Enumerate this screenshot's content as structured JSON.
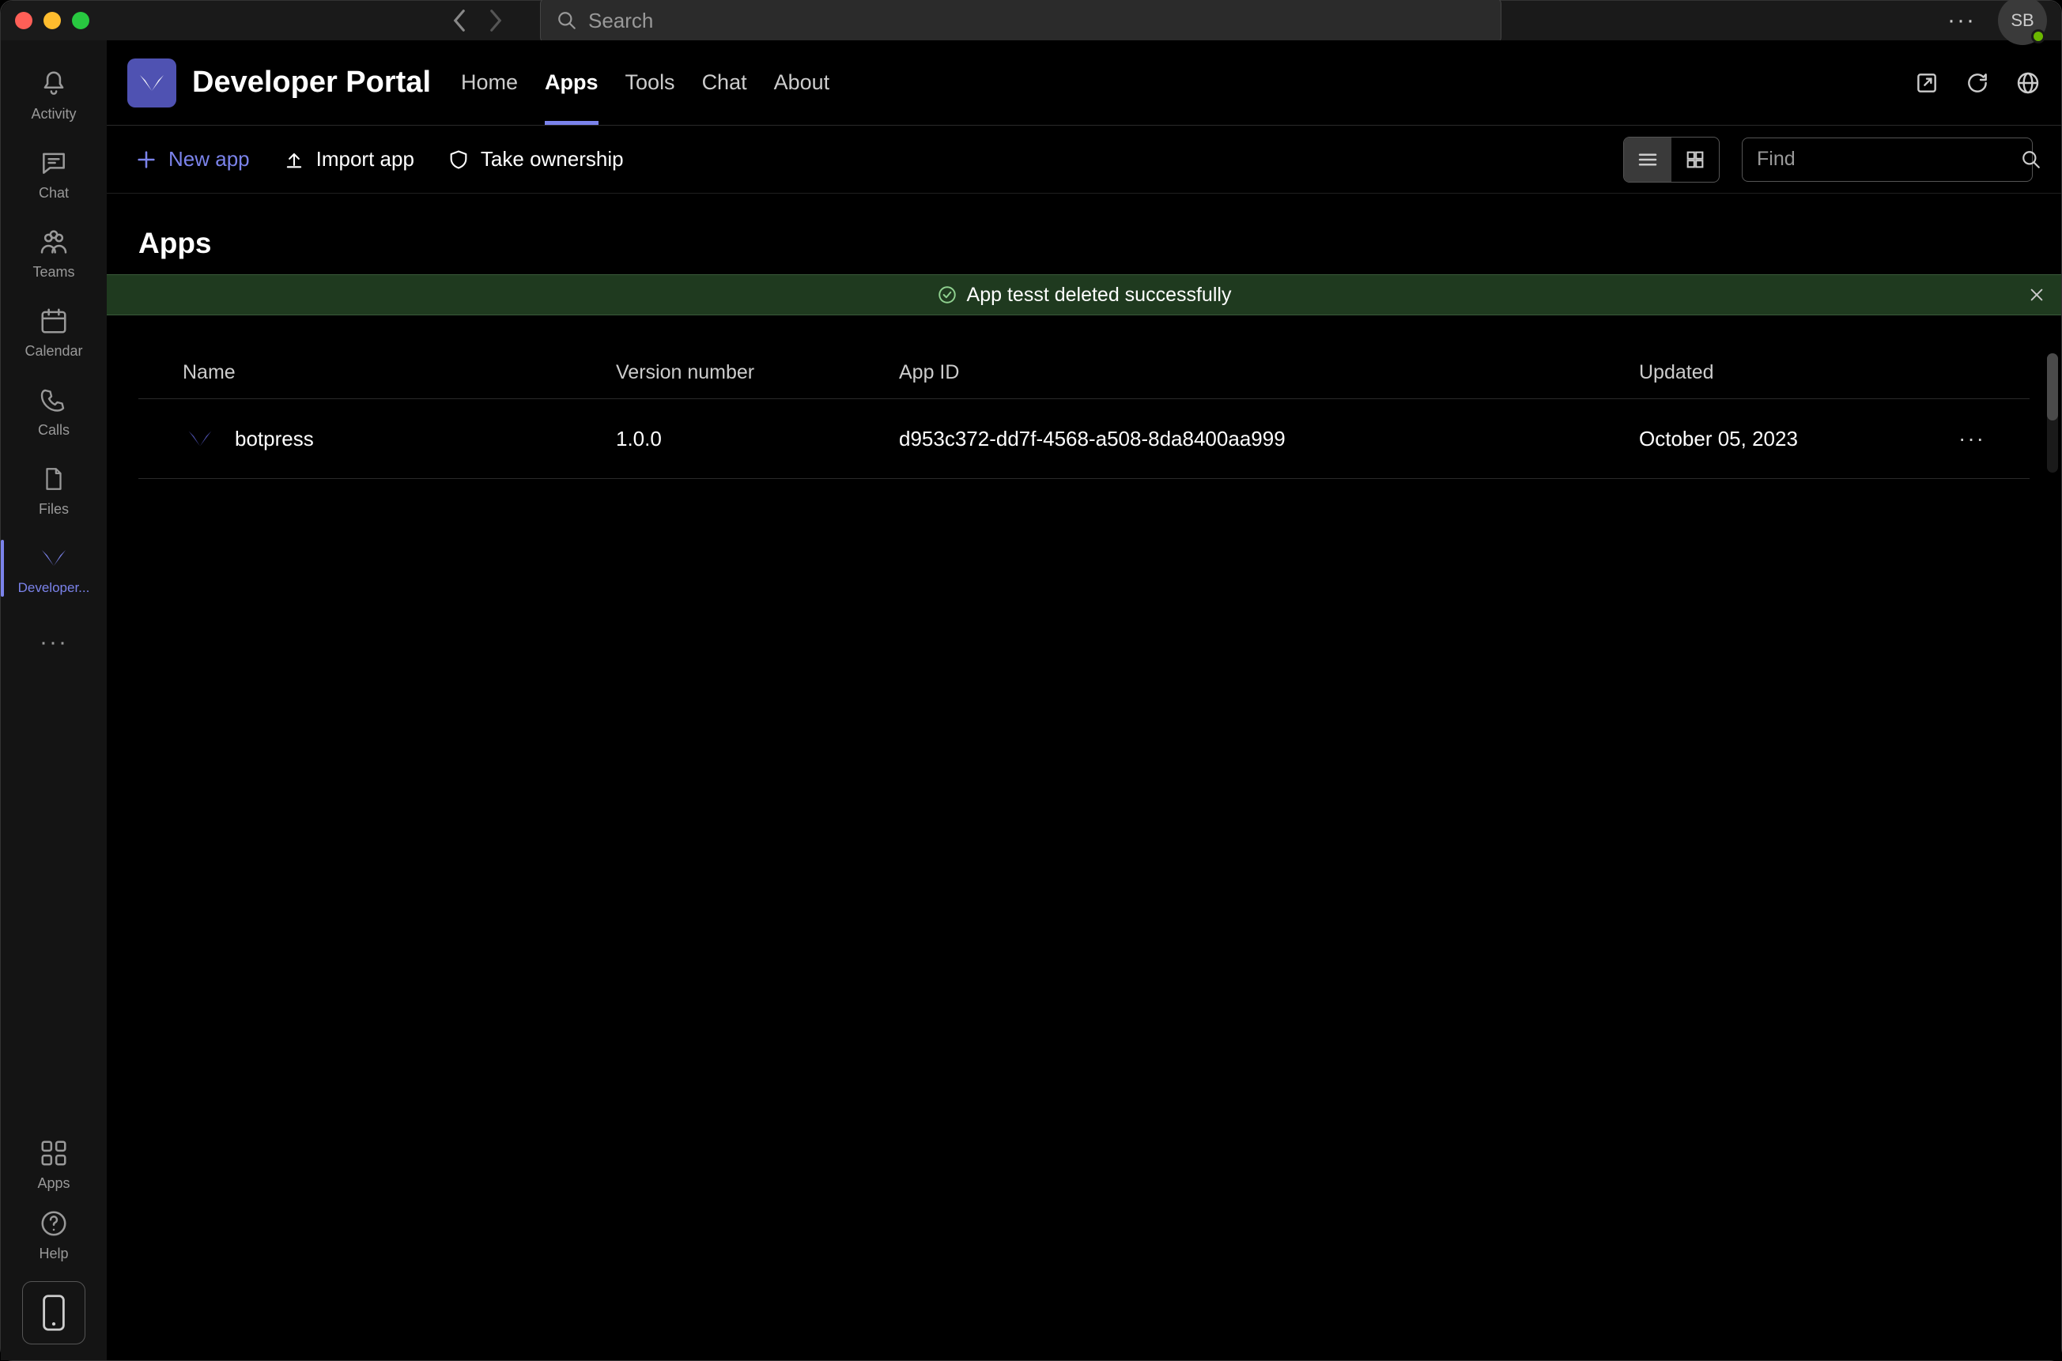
{
  "titlebar": {
    "search_placeholder": "Search",
    "avatar_initials": "SB"
  },
  "rail": {
    "items": [
      {
        "label": "Activity"
      },
      {
        "label": "Chat"
      },
      {
        "label": "Teams"
      },
      {
        "label": "Calendar"
      },
      {
        "label": "Calls"
      },
      {
        "label": "Files"
      },
      {
        "label": "Developer..."
      }
    ],
    "apps_label": "Apps",
    "help_label": "Help"
  },
  "header": {
    "title": "Developer Portal",
    "tabs": [
      {
        "label": "Home"
      },
      {
        "label": "Apps"
      },
      {
        "label": "Tools"
      },
      {
        "label": "Chat"
      },
      {
        "label": "About"
      }
    ]
  },
  "toolbar": {
    "new_app": "New app",
    "import_app": "Import app",
    "take_ownership": "Take ownership",
    "find_placeholder": "Find"
  },
  "page": {
    "title": "Apps",
    "notification": "App tesst deleted successfully"
  },
  "table": {
    "headers": {
      "name": "Name",
      "version": "Version number",
      "app_id": "App ID",
      "updated": "Updated"
    },
    "rows": [
      {
        "name": "botpress",
        "version": "1.0.0",
        "app_id": "d953c372-dd7f-4568-a508-8da8400aa999",
        "updated": "October 05, 2023"
      }
    ]
  }
}
